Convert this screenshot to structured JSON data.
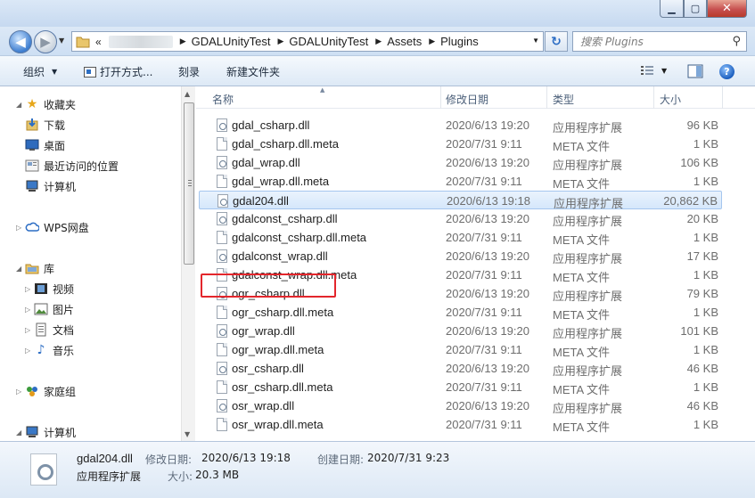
{
  "window": {
    "minimize": "▁",
    "maximize": "▢",
    "close": "✕"
  },
  "nav": {
    "back": "◀",
    "forward": "▶",
    "chevron": "«",
    "breadcrumb": [
      "GDALUnityTest",
      "GDALUnityTest",
      "Assets",
      "Plugins"
    ],
    "search_placeholder": "搜索 Plugins"
  },
  "toolbar": {
    "organize": "组织",
    "open_with": "打开方式...",
    "burn": "刻录",
    "new_folder": "新建文件夹"
  },
  "sidebar": {
    "favorites": "收藏夹",
    "downloads": "下载",
    "desktop": "桌面",
    "recent": "最近访问的位置",
    "computer": "计算机",
    "wps": "WPS网盘",
    "libraries": "库",
    "videos": "视频",
    "pictures": "图片",
    "documents": "文档",
    "music": "音乐",
    "homegroup": "家庭组",
    "computer2": "计算机"
  },
  "columns": {
    "name": "名称",
    "date": "修改日期",
    "type": "类型",
    "size": "大小"
  },
  "files": [
    {
      "name": "gdal_csharp.dll",
      "date": "2020/6/13 19:20",
      "type": "应用程序扩展",
      "size": "96 KB",
      "kind": "dll"
    },
    {
      "name": "gdal_csharp.dll.meta",
      "date": "2020/7/31 9:11",
      "type": "META 文件",
      "size": "1 KB",
      "kind": "meta"
    },
    {
      "name": "gdal_wrap.dll",
      "date": "2020/6/13 19:20",
      "type": "应用程序扩展",
      "size": "106 KB",
      "kind": "dll"
    },
    {
      "name": "gdal_wrap.dll.meta",
      "date": "2020/7/31 9:11",
      "type": "META 文件",
      "size": "1 KB",
      "kind": "meta"
    },
    {
      "name": "gdal204.dll",
      "date": "2020/6/13 19:18",
      "type": "应用程序扩展",
      "size": "20,862 KB",
      "kind": "dll",
      "selected": true
    },
    {
      "name": "gdalconst_csharp.dll",
      "date": "2020/6/13 19:20",
      "type": "应用程序扩展",
      "size": "20 KB",
      "kind": "dll"
    },
    {
      "name": "gdalconst_csharp.dll.meta",
      "date": "2020/7/31 9:11",
      "type": "META 文件",
      "size": "1 KB",
      "kind": "meta"
    },
    {
      "name": "gdalconst_wrap.dll",
      "date": "2020/6/13 19:20",
      "type": "应用程序扩展",
      "size": "17 KB",
      "kind": "dll"
    },
    {
      "name": "gdalconst_wrap.dll.meta",
      "date": "2020/7/31 9:11",
      "type": "META 文件",
      "size": "1 KB",
      "kind": "meta"
    },
    {
      "name": "ogr_csharp.dll",
      "date": "2020/6/13 19:20",
      "type": "应用程序扩展",
      "size": "79 KB",
      "kind": "dll"
    },
    {
      "name": "ogr_csharp.dll.meta",
      "date": "2020/7/31 9:11",
      "type": "META 文件",
      "size": "1 KB",
      "kind": "meta"
    },
    {
      "name": "ogr_wrap.dll",
      "date": "2020/6/13 19:20",
      "type": "应用程序扩展",
      "size": "101 KB",
      "kind": "dll"
    },
    {
      "name": "ogr_wrap.dll.meta",
      "date": "2020/7/31 9:11",
      "type": "META 文件",
      "size": "1 KB",
      "kind": "meta"
    },
    {
      "name": "osr_csharp.dll",
      "date": "2020/6/13 19:20",
      "type": "应用程序扩展",
      "size": "46 KB",
      "kind": "dll"
    },
    {
      "name": "osr_csharp.dll.meta",
      "date": "2020/7/31 9:11",
      "type": "META 文件",
      "size": "1 KB",
      "kind": "meta"
    },
    {
      "name": "osr_wrap.dll",
      "date": "2020/6/13 19:20",
      "type": "应用程序扩展",
      "size": "46 KB",
      "kind": "dll"
    },
    {
      "name": "osr_wrap.dll.meta",
      "date": "2020/7/31 9:11",
      "type": "META 文件",
      "size": "1 KB",
      "kind": "meta"
    }
  ],
  "details": {
    "name": "gdal204.dll",
    "type": "应用程序扩展",
    "modified_label": "修改日期:",
    "modified": "2020/6/13 19:18",
    "created_label": "创建日期:",
    "created": "2020/7/31 9:23",
    "size_label": "大小:",
    "size": "20.3 MB"
  },
  "colors": {
    "selection_bg": "#d5e7fb",
    "highlight_box": "#e3262c",
    "accent": "#2c6dc4"
  }
}
